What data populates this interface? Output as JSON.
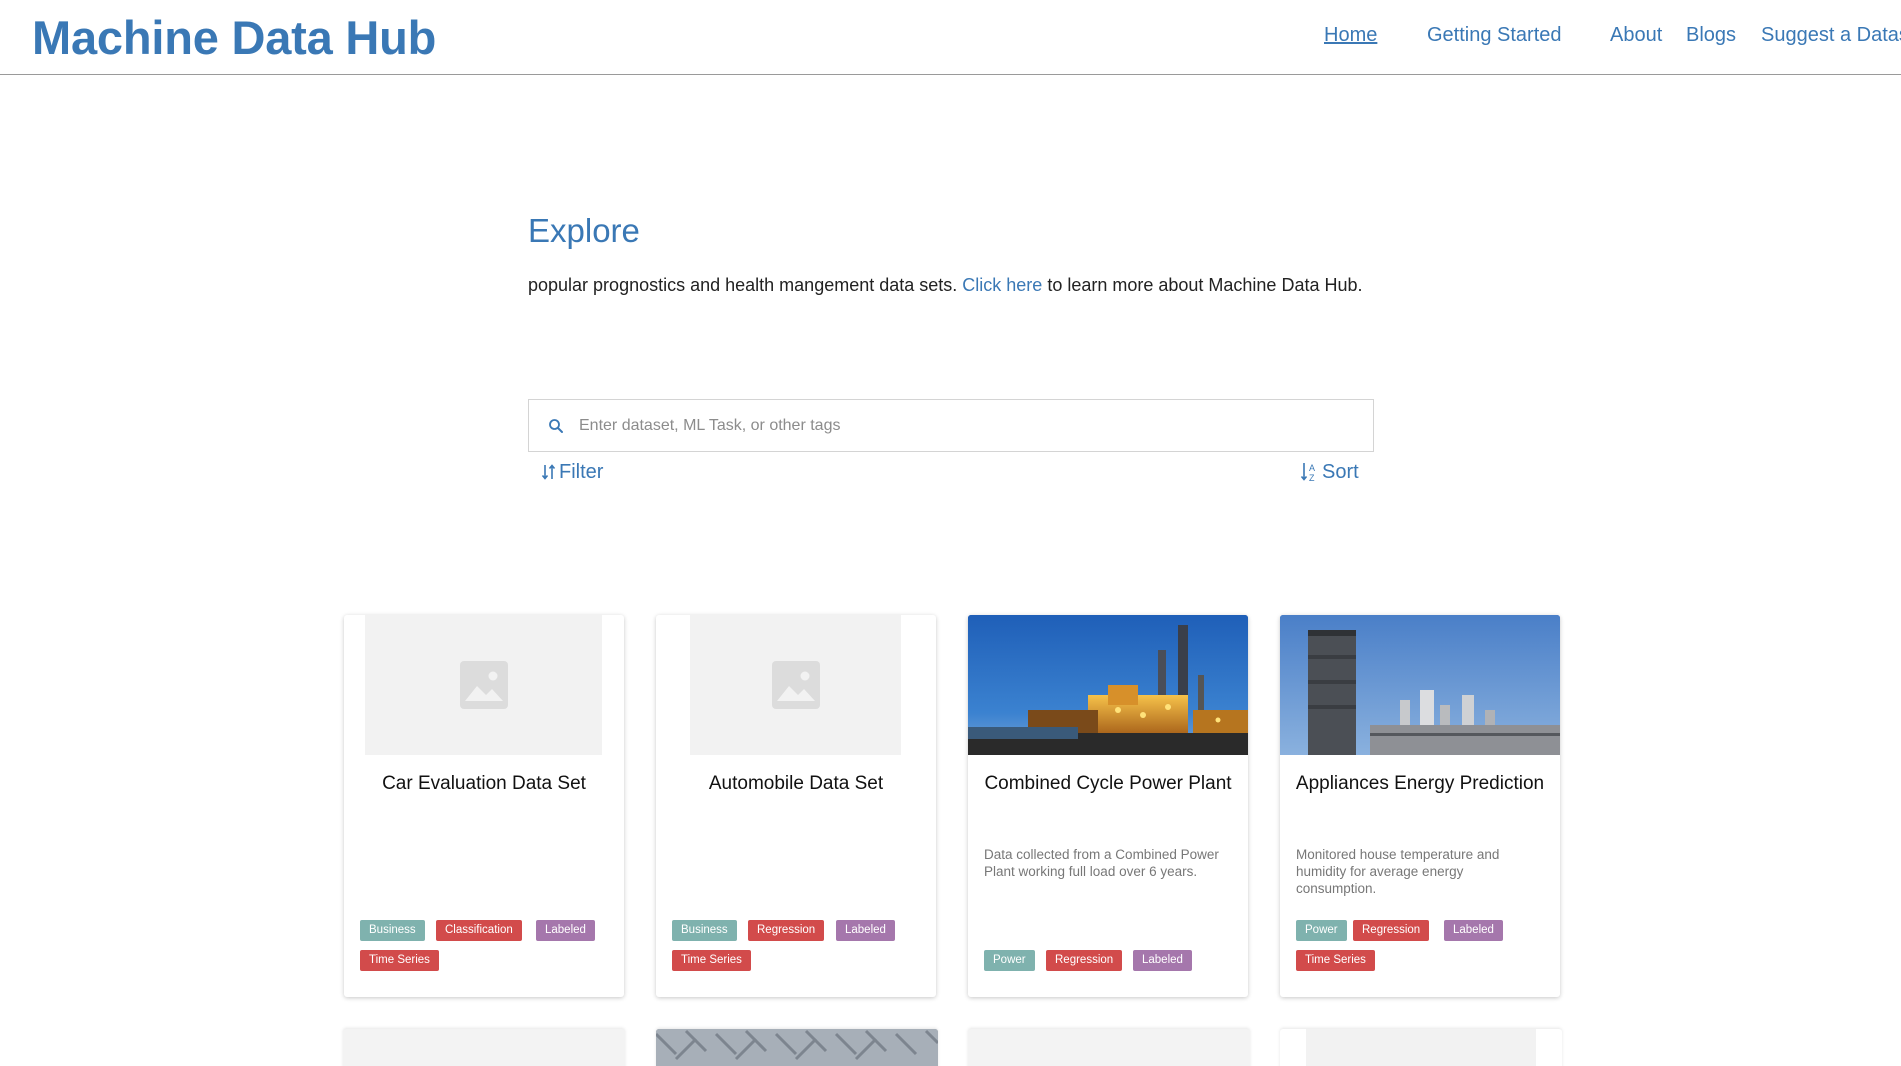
{
  "header": {
    "brand": "Machine Data Hub",
    "nav": [
      {
        "label": "Home",
        "active": true
      },
      {
        "label": "Getting Started"
      },
      {
        "label": "About"
      },
      {
        "label": "Blogs"
      },
      {
        "label": "Suggest a Dataset"
      }
    ]
  },
  "explore": {
    "title": "Explore",
    "desc_before": "popular prognostics and health mangement data sets. ",
    "link": "Click here",
    "desc_after": " to learn more about Machine Data Hub."
  },
  "search": {
    "placeholder": "Enter dataset, ML Task, or other tags",
    "value": ""
  },
  "controls": {
    "filter": "Filter",
    "sort": "Sort"
  },
  "cards": [
    {
      "title": "Car Evaluation Data Set",
      "desc": "",
      "image": "placeholder-image-icon",
      "tags": [
        {
          "label": "Business",
          "color": "teal"
        },
        {
          "label": "Classification",
          "color": "red"
        },
        {
          "label": "Labeled",
          "color": "purple"
        },
        {
          "label": "Time Series",
          "color": "red"
        }
      ]
    },
    {
      "title": "Automobile Data Set",
      "desc": "",
      "image": "placeholder-image-icon",
      "tags": [
        {
          "label": "Business",
          "color": "teal"
        },
        {
          "label": "Regression",
          "color": "red"
        },
        {
          "label": "Labeled",
          "color": "purple"
        },
        {
          "label": "Time Series",
          "color": "red"
        }
      ]
    },
    {
      "title": "Combined Cycle Power Plant",
      "desc": "Data collected from a Combined Power Plant working full load over 6 years.",
      "image": "power-plant-night-photo",
      "tags": [
        {
          "label": "Power",
          "color": "teal"
        },
        {
          "label": "Regression",
          "color": "red"
        },
        {
          "label": "Labeled",
          "color": "purple"
        }
      ]
    },
    {
      "title": "Appliances Energy Prediction",
      "desc": "Monitored house temperature and humidity for average energy consumption.",
      "image": "industrial-chimney-photo",
      "tags": [
        {
          "label": "Power",
          "color": "teal"
        },
        {
          "label": "Regression",
          "color": "red"
        },
        {
          "label": "Labeled",
          "color": "purple"
        },
        {
          "label": "Time Series",
          "color": "red"
        }
      ]
    }
  ],
  "colors": {
    "accent": "#3a78b5",
    "tag_teal": "#7fb2ae",
    "tag_red": "#d24b4b",
    "tag_purple": "#a577ac"
  }
}
